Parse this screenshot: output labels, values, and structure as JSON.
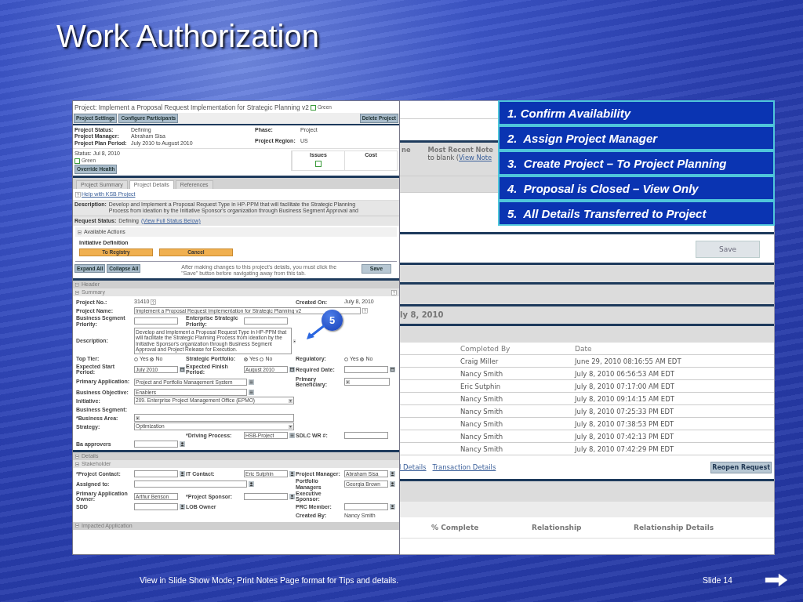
{
  "slide": {
    "title": "Work Authorization",
    "footer": "View in Slide Show Mode; Print Notes Page format for Tips and details.",
    "slide_number": "Slide 14"
  },
  "back_screenshot": {
    "column_fragment": "ne",
    "notes_label": "Most Recent Note",
    "notes_text": "to blank (",
    "notes_link": "View Note",
    "save_button": "Save",
    "date_heading": "ly 8, 2010",
    "table": {
      "columns": [
        "Completed By",
        "Date"
      ],
      "rows": [
        [
          "Craig Miller",
          "June 29, 2010 08:16:55 AM EDT"
        ],
        [
          "Nancy Smith",
          "July 8, 2010 06:56:53 AM EDT"
        ],
        [
          "Eric Sutphin",
          "July 8, 2010 07:17:00 AM EDT"
        ],
        [
          "Nancy Smith",
          "July 8, 2010 09:14:15 AM EDT"
        ],
        [
          "Nancy Smith",
          "July 8, 2010 07:25:33 PM EDT"
        ],
        [
          "Nancy Smith",
          "July 8, 2010 07:38:53 PM EDT"
        ],
        [
          "Nancy Smith",
          "July 8, 2010 07:42:13 PM EDT"
        ],
        [
          "Nancy Smith",
          "July 8, 2010 07:42:29 PM EDT"
        ]
      ]
    },
    "links": [
      "l Details",
      "Transaction Details"
    ],
    "reopen_button": "Reopen Request",
    "relations_columns": [
      "% Complete",
      "Relationship",
      "Relationship Details"
    ]
  },
  "front_screenshot": {
    "title": "Project: Implement a Proposal Request Implementation for Strategic Planning v2",
    "title_status": "Green",
    "toolbar_left": [
      "Project Settings",
      "Configure Participants"
    ],
    "toolbar_right": "Delete Project",
    "info_left": [
      {
        "label": "Project Status:",
        "value": "Defining"
      },
      {
        "label": "Project Manager:",
        "value": "Abraham Sisa"
      },
      {
        "label": "Project Plan Period:",
        "value": "July 2010 to August 2010"
      }
    ],
    "info_right": [
      {
        "label": "Phase:",
        "value": "Project"
      },
      {
        "label": "Project Region:",
        "value": "US"
      }
    ],
    "status_date": "Status: Jul 8, 2010",
    "status_health": "Green",
    "override_button": "Override Health",
    "health": [
      {
        "label": "Issues",
        "color": "#3a9a3a"
      },
      {
        "label": "Cost"
      }
    ],
    "tabs": [
      {
        "label": "Project Summary",
        "selected": false
      },
      {
        "label": "Project Details",
        "selected": true
      },
      {
        "label": "References",
        "selected": false
      }
    ],
    "help_link": "Help with KSB Project",
    "description": {
      "label": "Description:",
      "text": "Develop and Implement a Proposal Request Type in HP-PPM that will facilitate the Strategic Planning Process from ideation by the Initiative Sponsor's organization through Business Segment Approval and"
    },
    "request_status": {
      "label": "Request Status:",
      "value": "Defining",
      "link": "(View Full Status Below)"
    },
    "actions": {
      "title": "Available Actions",
      "subtitle": "Initiative Definition",
      "buttons": [
        "To Registry",
        "Cancel"
      ]
    },
    "expand_buttons": [
      "Expand All",
      "Collapse All"
    ],
    "save_note": "After making changes to this project's details, you must click the \"Save\" button before navigating away from this tab.",
    "save_button": "Save",
    "sections": [
      {
        "title": "Header",
        "kind": "group"
      },
      {
        "title": "Summary",
        "kind": "subsection",
        "help": true,
        "rows": [
          [
            {
              "label": "Project No.:",
              "kind": "static",
              "value": "31410",
              "help": true
            },
            {
              "kind": "blank"
            },
            {
              "label": "Created On:",
              "kind": "static",
              "value": "July 8, 2010"
            }
          ],
          [
            {
              "label": "Project Name:",
              "kind": "wide_text",
              "value": "Implement a Proposal Request Implementation for Strategic Planning v2",
              "help": true
            }
          ],
          [
            {
              "label": "Business Segment Priority:",
              "kind": "text"
            },
            {
              "label": "Enterprise Strategic Priority:",
              "kind": "text"
            }
          ],
          [
            {
              "label": "Description:",
              "kind": "textarea",
              "value": "Develop and implement a Proposal Request Type in HP-PPM that will facilitate the Strategic Planning Process from ideation by the Initiative Sponsor's organization through Business Segment Approval and Project Release for Execution."
            }
          ],
          [
            {
              "label": "Top Tier:",
              "kind": "radio",
              "options": [
                {
                  "label": "Yes",
                  "selected": false
                },
                {
                  "label": "No",
                  "selected": true
                }
              ]
            },
            {
              "label": "Strategic Portfolio:",
              "kind": "radio",
              "options": [
                {
                  "label": "Yes",
                  "selected": true
                },
                {
                  "label": "No",
                  "selected": false
                }
              ]
            },
            {
              "label": "Regulatory:",
              "kind": "radio",
              "options": [
                {
                  "label": "Yes",
                  "selected": false
                },
                {
                  "label": "No",
                  "selected": true
                }
              ]
            }
          ],
          [
            {
              "label": "Expected Start Period:",
              "kind": "date",
              "value": "July 2010"
            },
            {
              "label": "Expected Finish Period:",
              "kind": "date",
              "value": "August 2010"
            },
            {
              "label": "Required Date:",
              "kind": "date"
            }
          ],
          [
            {
              "label": "Primary Application:",
              "kind": "wide_lookup",
              "value": "Project and Portfolio Management System"
            },
            "",
            {
              "label": "Primary Beneficiary:",
              "kind": "select"
            }
          ],
          [
            {
              "label": "Business Objective:",
              "kind": "wide_lookup",
              "value": "Enablers"
            }
          ],
          [
            {
              "label": "Initiative:",
              "kind": "wide_select",
              "value": "209. Enterprise Project Management Office (EPMO)"
            }
          ],
          [
            {
              "label": "Business Segment:",
              "kind": "none"
            }
          ],
          [
            {
              "label": "*Business Area:",
              "kind": "wide_select"
            }
          ],
          [
            {
              "label": "Strategy:",
              "kind": "wide_select",
              "value": "Optimization"
            }
          ],
          [
            {
              "kind": "blank"
            },
            {
              "label": "*Driving Process:",
              "kind": "lookup",
              "value": "HSB-Project"
            },
            {
              "label": "SDLC WR #:",
              "kind": "text"
            }
          ],
          [
            {
              "label": "Ba approvers",
              "kind": "person"
            }
          ]
        ]
      },
      {
        "title": "Details",
        "kind": "group"
      },
      {
        "title": "Stakeholder",
        "kind": "subsection",
        "rows": [
          [
            {
              "label": "*Project Contact:",
              "kind": "person"
            },
            {
              "label": "IT Contact:",
              "kind": "person",
              "value": "Eric Sutphin"
            },
            {
              "label": "Project Manager:",
              "kind": "person",
              "value": "Abraham Sisa"
            }
          ],
          [
            {
              "label": "Assigned to:",
              "kind": "wide_person"
            },
            "",
            {
              "label": "Portfolio Managers",
              "kind": "person",
              "value": "Georgia Brown"
            }
          ],
          [
            {
              "label": "Primary Application Owner:",
              "kind": "text",
              "value": "Arthur Benson"
            },
            {
              "label": "*Project Sponsor:",
              "kind": "person"
            },
            {
              "label": "Executive Sponsor:",
              "kind": "none"
            }
          ],
          [
            {
              "label": "SDD",
              "kind": "person"
            },
            {
              "label": "LOB Owner",
              "kind": "none"
            },
            {
              "label": "PRC Member:",
              "kind": "person"
            }
          ],
          [
            {
              "kind": "blank"
            },
            {
              "kind": "blank"
            },
            {
              "label": "Created By:",
              "kind": "static",
              "value": "Nancy Smith"
            }
          ]
        ]
      },
      {
        "title": "Impacted Application",
        "kind": "group"
      }
    ]
  },
  "steps": [
    "1. Confirm Availability",
    "2.  Assign Project Manager",
    "3.  Create Project – To Project Planning",
    "4.  Proposal is Closed – View Only",
    "5.  All Details Transferred to Project"
  ],
  "callout": {
    "number": "5"
  }
}
